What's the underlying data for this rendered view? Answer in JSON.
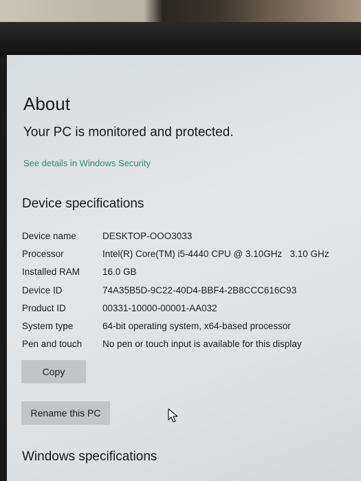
{
  "about": {
    "title": "About",
    "protection_status": "Your PC is monitored and protected.",
    "security_link": "See details in Windows Security"
  },
  "device_specifications": {
    "title": "Device specifications",
    "rows": [
      {
        "label": "Device name",
        "value": "DESKTOP-OOO3033"
      },
      {
        "label": "Processor",
        "value": "Intel(R) Core(TM) i5-4440 CPU @ 3.10GHz   3.10 GHz"
      },
      {
        "label": "Installed RAM",
        "value": "16.0 GB"
      },
      {
        "label": "Device ID",
        "value": "74A35B5D-9C22-40D4-BBF4-2B8CCC616C93"
      },
      {
        "label": "Product ID",
        "value": "00331-10000-00001-AA032"
      },
      {
        "label": "System type",
        "value": "64-bit operating system, x64-based processor"
      },
      {
        "label": "Pen and touch",
        "value": "No pen or touch input is available for this display"
      }
    ],
    "copy_button": "Copy",
    "rename_button": "Rename this PC"
  },
  "windows_specifications": {
    "title": "Windows specifications"
  },
  "colors": {
    "link": "#3a8a6f",
    "button": "#c2c5c8",
    "background": "#e0e3e5"
  }
}
